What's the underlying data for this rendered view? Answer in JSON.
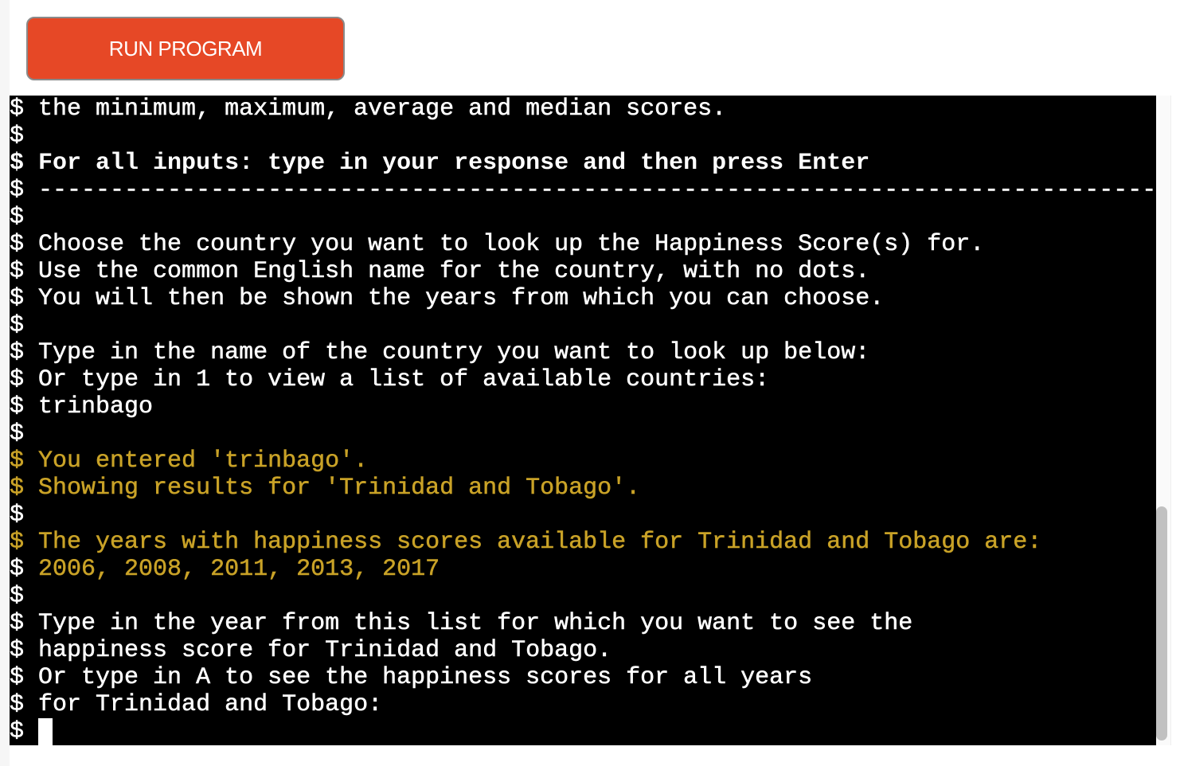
{
  "run_button": {
    "label": "RUN PROGRAM"
  },
  "terminal": {
    "prompt": "$",
    "lines": [
      {
        "text": "the minimum, maximum, average and median scores.",
        "style": "normal"
      },
      {
        "text": "",
        "style": "normal"
      },
      {
        "text": "For all inputs: type in your response and then press Enter",
        "style": "bold"
      },
      {
        "text": "------------------------------------------------------------------------------",
        "style": "normal"
      },
      {
        "text": "",
        "style": "normal"
      },
      {
        "text": "Choose the country you want to look up the Happiness Score(s) for.",
        "style": "normal"
      },
      {
        "text": "Use the common English name for the country, with no dots.",
        "style": "normal"
      },
      {
        "text": "You will then be shown the years from which you can choose.",
        "style": "normal"
      },
      {
        "text": "",
        "style": "normal"
      },
      {
        "text": "Type in the name of the country you want to look up below:",
        "style": "normal"
      },
      {
        "text": "Or type in 1 to view a list of available countries:",
        "style": "normal"
      },
      {
        "text": "trinbago",
        "style": "normal"
      },
      {
        "text": "",
        "style": "normal"
      },
      {
        "text": "You entered 'trinbago'.",
        "style": "yellow"
      },
      {
        "text": "Showing results for 'Trinidad and Tobago'.",
        "style": "yellow"
      },
      {
        "text": "",
        "style": "normal"
      },
      {
        "text": "The years with happiness scores available for Trinidad and Tobago are:",
        "style": "yellow"
      },
      {
        "text": "2006, 2008, 2011, 2013, 2017",
        "style": "yellow-text"
      },
      {
        "text": "",
        "style": "normal"
      },
      {
        "text": "Type in the year from this list for which you want to see the",
        "style": "normal"
      },
      {
        "text": "happiness score for Trinidad and Tobago.",
        "style": "normal"
      },
      {
        "text": "Or type in A to see the happiness scores for all years",
        "style": "normal"
      },
      {
        "text": "for Trinidad and Tobago:",
        "style": "normal"
      }
    ],
    "input_value": ""
  },
  "colors": {
    "button": "#e64826",
    "highlight": "#c9a227",
    "terminal_bg": "#000000"
  }
}
